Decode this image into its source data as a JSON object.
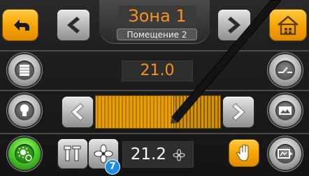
{
  "header": {
    "zone_title": "Зона 1",
    "room_label": "Помещение 2"
  },
  "controls": {
    "setpoint_value": "21.0",
    "current_value": "21.2"
  },
  "badge": {
    "number": "7"
  },
  "icons": {
    "back": "back-arrow-icon",
    "home": "home-icon",
    "prev": "chevron-left-icon",
    "next": "chevron-right-icon",
    "blinds": "blinds-icon",
    "light": "light-bulb-icon",
    "scene": "scene-icon",
    "switch": "switch-icon",
    "image": "image-icon",
    "image_arrow": "image-arrow-icon",
    "tools": "tools-icon",
    "fan": "fan-icon",
    "hand": "hand-icon"
  },
  "colors": {
    "accent_orange": "#f7931e",
    "button_orange": "#f5a300",
    "badge_blue": "#1e8fe0",
    "active_green": "#4fd12b"
  }
}
